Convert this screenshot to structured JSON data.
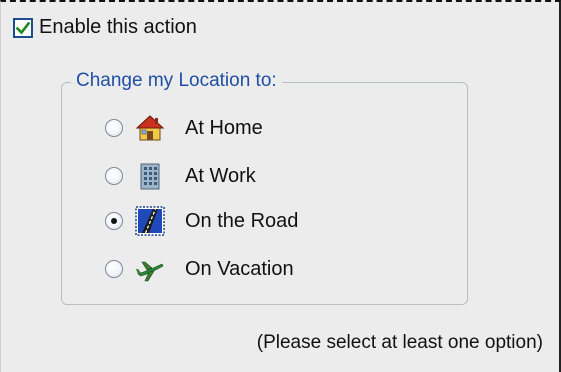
{
  "enable": {
    "label": "Enable this action",
    "checked": true
  },
  "group": {
    "title": "Change my Location to:"
  },
  "options": [
    {
      "label": "At Home",
      "icon": "house-icon",
      "selected": false
    },
    {
      "label": "At Work",
      "icon": "office-building-icon",
      "selected": false
    },
    {
      "label": "On the Road",
      "icon": "road-icon",
      "selected": true
    },
    {
      "label": "On Vacation",
      "icon": "airplane-icon",
      "selected": false
    }
  ],
  "hint": "(Please select at least one option)",
  "colors": {
    "group_title": "#1f4fa5",
    "checkbox_border": "#1c4f8f",
    "checkmark": "#1e8a1e",
    "background": "#ececec"
  }
}
